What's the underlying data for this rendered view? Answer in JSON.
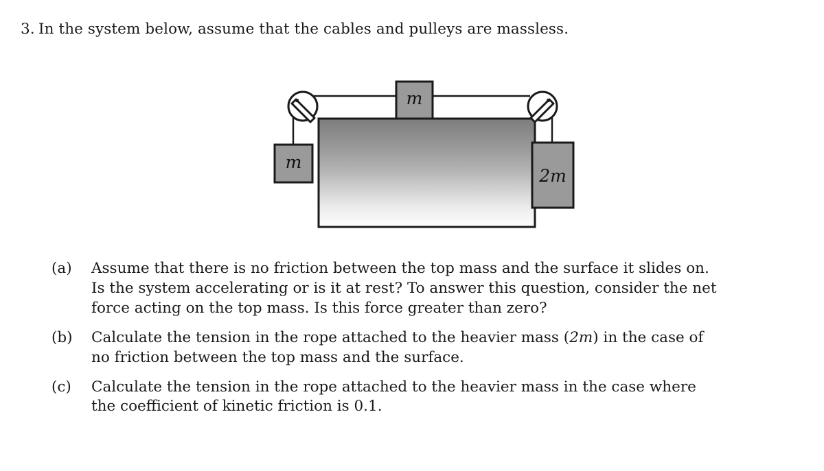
{
  "problem": {
    "number": "3.",
    "statement": "In the system below, assume that the cables and pulleys are massless."
  },
  "figure": {
    "caption_hidden": "Two pulleys at the edges of a table; a block m on the table connected by cables over both pulleys to a hanging block m on the left and a hanging block 2m on the right.",
    "labels": {
      "top_mass": "m",
      "left_mass": "m",
      "right_mass": "2m"
    },
    "colors": {
      "block_fill": "#9a9a9a",
      "outline": "#1a1a1a",
      "table_gradient_top": "#808080",
      "table_gradient_bottom": "#fcfcfc",
      "pulley_fill": "#ffffff",
      "cable": "#1a1a1a"
    }
  },
  "parts": [
    {
      "tag": "(a)",
      "lines": [
        "Assume that there is no friction between the top mass and the surface it slides on.",
        "Is the system accelerating or is it at rest?  To answer this question, consider the net",
        "force acting on the top mass.  Is this force greater than zero?"
      ]
    },
    {
      "tag": "(b)",
      "lines": [
        "Calculate the tension in the rope attached to the heavier mass (2m) in the case of",
        "no friction between the top mass and the surface."
      ],
      "math_tokens": [
        "2m"
      ]
    },
    {
      "tag": "(c)",
      "lines": [
        "Calculate the tension in the rope attached to the heavier mass in the case where",
        "the coefficient of kinetic friction is 0.1."
      ],
      "friction_coefficient": "0.1"
    }
  ]
}
